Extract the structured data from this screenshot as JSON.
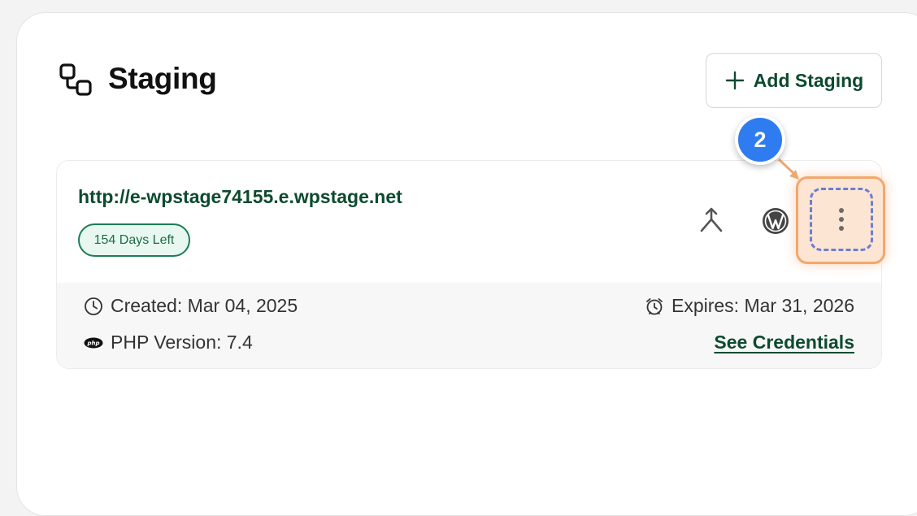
{
  "header": {
    "title": "Staging",
    "icon": "staging-icon",
    "add_button_label": "Add Staging",
    "add_button_icon": "plus-icon"
  },
  "staging_site": {
    "url": "http://e-wpstage74155.e.wpstage.net",
    "days_left_badge": "154 Days Left",
    "actions": {
      "merge_icon": "merge-icon",
      "wordpress_icon": "wordpress-icon",
      "more_icon": "more-vertical-icon"
    },
    "created": "Created: Mar 04, 2025",
    "expires": "Expires: Mar 31, 2026",
    "php_version": "PHP Version: 7.4",
    "credentials_link": "See Credentials"
  },
  "annotation": {
    "step_number": "2",
    "badge_color": "#2f7bf0",
    "highlight_color": "#f2a86c"
  },
  "colors": {
    "brand_green": "#0d4a2f",
    "badge_green": "#1d7d55",
    "badge_bg": "#e8f8f0"
  }
}
